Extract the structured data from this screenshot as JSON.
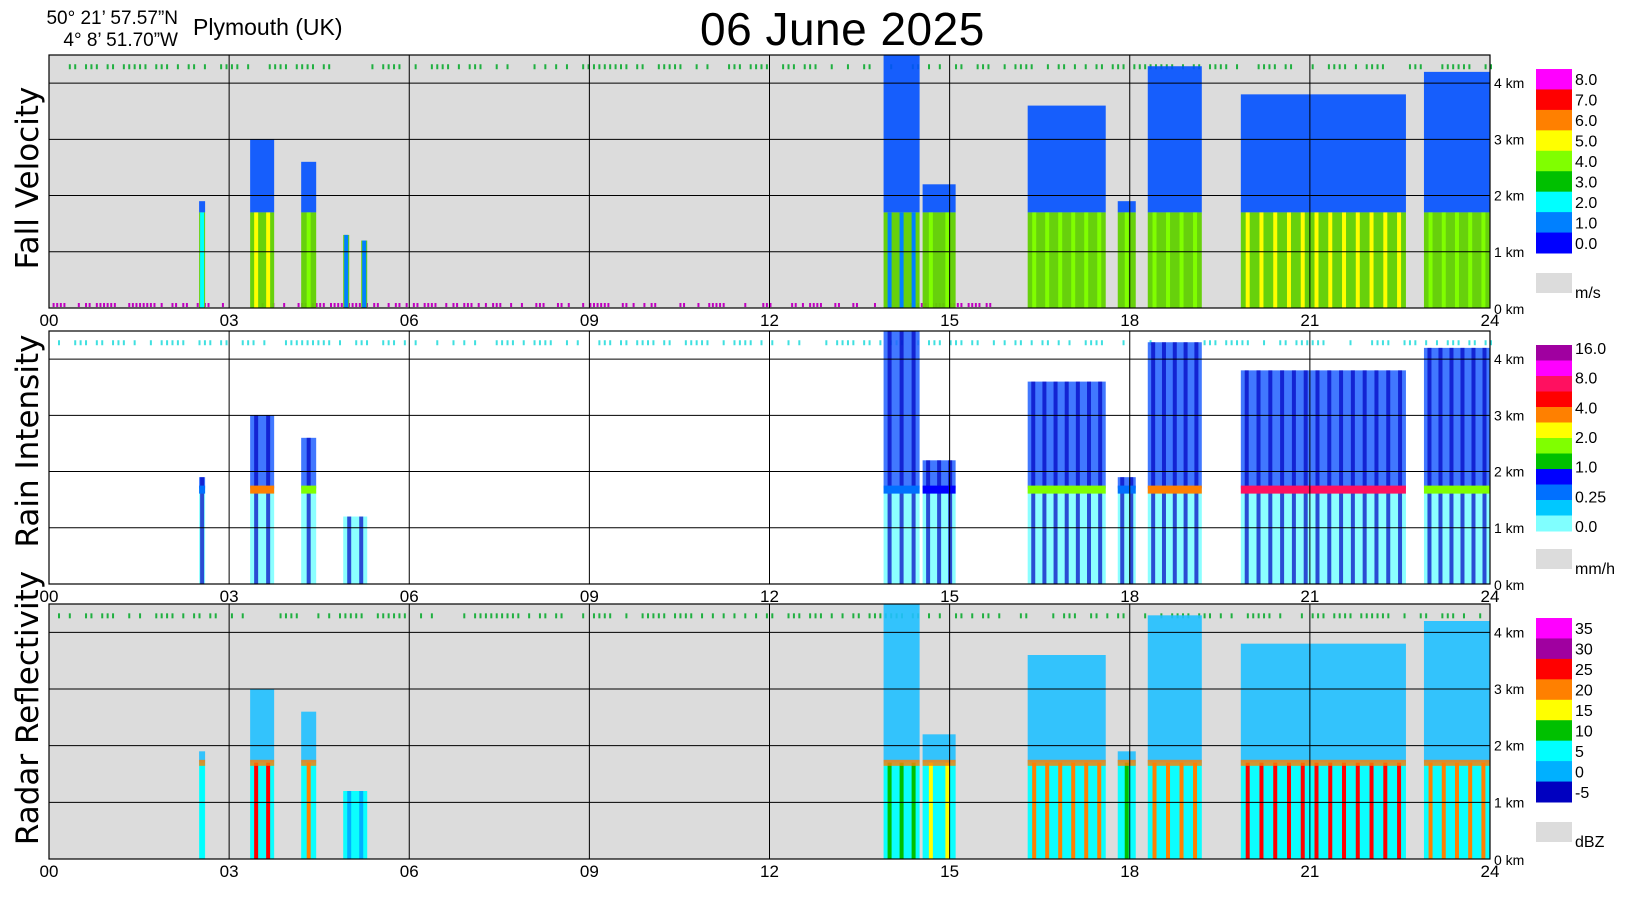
{
  "header": {
    "lat": "50° 21’ 57.57”N",
    "lon": "4°  8’ 51.70”W",
    "location": "Plymouth (UK)",
    "title": "06 June  2025"
  },
  "chart_data": [
    {
      "type": "heatmap",
      "ylabel": "Fall Velocity",
      "x_ticks": [
        "00",
        "03",
        "06",
        "09",
        "12",
        "15",
        "18",
        "21",
        "24"
      ],
      "y_ticks": [
        "0 km",
        "1 km",
        "2 km",
        "3 km",
        "4 km"
      ],
      "x_range_hours": [
        0,
        24
      ],
      "y_range_km": [
        0,
        4.5
      ],
      "grid": true,
      "colorbar": {
        "unit": "m/s",
        "labels": [
          "8.0",
          "7.0",
          "6.0",
          "5.0",
          "4.0",
          "3.0",
          "2.0",
          "1.0",
          "0.0"
        ],
        "colors": [
          "#ff00ff",
          "#ff0000",
          "#ff8000",
          "#ffff00",
          "#80ff00",
          "#00c000",
          "#00ffff",
          "#0080ff",
          "#0000ff"
        ],
        "nodata_color": "#dcdcdc"
      },
      "precip_events": [
        {
          "start": 2.5,
          "end": 2.6,
          "top_km": 1.9,
          "core_value": 2.0
        },
        {
          "start": 3.35,
          "end": 3.75,
          "top_km": 3.0,
          "core_value": 5.0
        },
        {
          "start": 4.2,
          "end": 4.45,
          "top_km": 2.6,
          "core_value": 4.5
        },
        {
          "start": 4.9,
          "end": 5.0,
          "top_km": 1.3,
          "core_value": 1.0
        },
        {
          "start": 5.2,
          "end": 5.3,
          "top_km": 1.2,
          "core_value": 1.0
        },
        {
          "start": 13.9,
          "end": 14.5,
          "top_km": 4.5,
          "core_value": 1.0
        },
        {
          "start": 14.55,
          "end": 15.1,
          "top_km": 2.2,
          "core_value": 4.0
        },
        {
          "start": 16.3,
          "end": 17.6,
          "top_km": 3.6,
          "core_value": 4.5
        },
        {
          "start": 17.8,
          "end": 18.1,
          "top_km": 1.9,
          "core_value": 4.0
        },
        {
          "start": 18.3,
          "end": 19.2,
          "top_km": 4.3,
          "core_value": 4.5
        },
        {
          "start": 19.85,
          "end": 22.6,
          "top_km": 3.8,
          "core_value": 5.5
        },
        {
          "start": 22.9,
          "end": 24.0,
          "top_km": 4.2,
          "core_value": 4.5
        }
      ]
    },
    {
      "type": "heatmap",
      "ylabel": "Rain Intensity",
      "x_ticks": [
        "00",
        "03",
        "06",
        "09",
        "12",
        "15",
        "18",
        "21",
        "24"
      ],
      "y_ticks": [
        "0 km",
        "1 km",
        "2 km",
        "3 km",
        "4 km"
      ],
      "x_range_hours": [
        0,
        24
      ],
      "y_range_km": [
        0,
        4.5
      ],
      "grid": true,
      "colorbar": {
        "unit": "mm/h",
        "labels": [
          "16.0",
          "8.0",
          "4.0",
          "2.0",
          "1.0",
          "0.25",
          "0.0"
        ],
        "colors": [
          "#a000a0",
          "#ff00ff",
          "#ff1060",
          "#ff0000",
          "#ff8000",
          "#ffff00",
          "#80ff00",
          "#00c000",
          "#0000ff",
          "#0070ff",
          "#00c8ff",
          "#80ffff"
        ],
        "nodata_color": "#dcdcdc"
      },
      "precip_events": [
        {
          "start": 2.5,
          "end": 2.6,
          "top_km": 1.9,
          "core_value": 0.5
        },
        {
          "start": 3.35,
          "end": 3.75,
          "top_km": 3.0,
          "core_value": 4.0
        },
        {
          "start": 4.2,
          "end": 4.45,
          "top_km": 2.6,
          "core_value": 2.0
        },
        {
          "start": 4.9,
          "end": 5.3,
          "top_km": 1.2,
          "core_value": 0.1
        },
        {
          "start": 13.9,
          "end": 14.5,
          "top_km": 4.5,
          "core_value": 0.5
        },
        {
          "start": 14.55,
          "end": 15.1,
          "top_km": 2.2,
          "core_value": 1.0
        },
        {
          "start": 16.3,
          "end": 17.6,
          "top_km": 3.6,
          "core_value": 2.0
        },
        {
          "start": 17.8,
          "end": 18.1,
          "top_km": 1.9,
          "core_value": 0.5
        },
        {
          "start": 18.3,
          "end": 19.2,
          "top_km": 4.3,
          "core_value": 4.0
        },
        {
          "start": 19.85,
          "end": 22.6,
          "top_km": 3.8,
          "core_value": 8.0
        },
        {
          "start": 22.9,
          "end": 24.0,
          "top_km": 4.2,
          "core_value": 2.0
        }
      ]
    },
    {
      "type": "heatmap",
      "ylabel": "Radar Reflectivity",
      "x_ticks": [
        "00",
        "03",
        "06",
        "09",
        "12",
        "15",
        "18",
        "21",
        "24"
      ],
      "y_ticks": [
        "0 km",
        "1 km",
        "2 km",
        "3 km",
        "4 km"
      ],
      "x_range_hours": [
        0,
        24
      ],
      "y_range_km": [
        0,
        4.5
      ],
      "grid": true,
      "colorbar": {
        "unit": "dBZ",
        "labels": [
          "35",
          "30",
          "25",
          "20",
          "15",
          "10",
          "5",
          "0",
          "-5"
        ],
        "colors": [
          "#ff00ff",
          "#a000a0",
          "#ff0000",
          "#ff8000",
          "#ffff00",
          "#00c000",
          "#00ffff",
          "#00b0ff",
          "#0000c0"
        ],
        "nodata_color": "#dcdcdc"
      },
      "precip_events": [
        {
          "start": 2.5,
          "end": 2.6,
          "top_km": 1.9,
          "core_value": 5
        },
        {
          "start": 3.35,
          "end": 3.75,
          "top_km": 3.0,
          "core_value": 25
        },
        {
          "start": 4.2,
          "end": 4.45,
          "top_km": 2.6,
          "core_value": 20
        },
        {
          "start": 4.9,
          "end": 5.3,
          "top_km": 1.2,
          "core_value": 0
        },
        {
          "start": 13.9,
          "end": 14.5,
          "top_km": 4.5,
          "core_value": 10
        },
        {
          "start": 14.55,
          "end": 15.1,
          "top_km": 2.2,
          "core_value": 15
        },
        {
          "start": 16.3,
          "end": 17.6,
          "top_km": 3.6,
          "core_value": 20
        },
        {
          "start": 17.8,
          "end": 18.1,
          "top_km": 1.9,
          "core_value": 10
        },
        {
          "start": 18.3,
          "end": 19.2,
          "top_km": 4.3,
          "core_value": 20
        },
        {
          "start": 19.85,
          "end": 22.6,
          "top_km": 3.8,
          "core_value": 25
        },
        {
          "start": 22.9,
          "end": 24.0,
          "top_km": 4.2,
          "core_value": 20
        }
      ]
    }
  ]
}
